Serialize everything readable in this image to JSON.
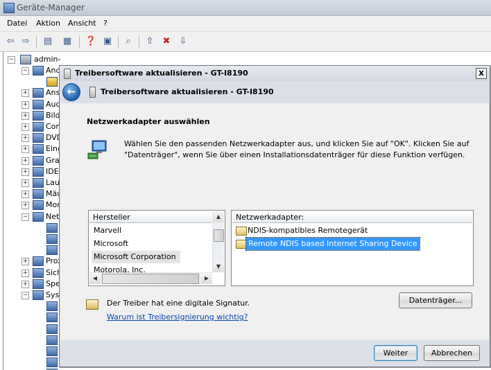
{
  "device_manager": {
    "title": "Geräte-Manager",
    "menu": [
      "Datei",
      "Aktion",
      "Ansicht",
      "?"
    ],
    "toolbar_icons": [
      "back-arrow-icon",
      "forward-arrow-icon",
      "console-tree-icon",
      "properties-icon",
      "help-icon",
      "action-pane-icon",
      "scan-hardware-icon",
      "update-driver-icon",
      "disable-device-icon",
      "uninstall-device-icon"
    ],
    "tree": {
      "root": "admin-PC",
      "items": [
        "And",
        "",
        "Ans",
        "Aud",
        "Bild",
        "Com",
        "DVD",
        "Eing",
        "Graf",
        "IDE",
        "Lauf",
        "Mäu",
        "Mon",
        "Netz",
        "",
        "",
        "",
        "Proz",
        "Sich",
        "Spe",
        "Syst",
        "",
        "",
        "",
        "",
        "",
        "",
        ""
      ]
    }
  },
  "dialog": {
    "title": "Treibersoftware aktualisieren - GT-I8190",
    "header_title": "Treibersoftware aktualisieren - GT-I8190",
    "section_title": "Netzwerkadapter auswählen",
    "description": "Wählen Sie den passenden Netzwerkadapter aus, und klicken Sie auf \"OK\". Klicken Sie auf \"Datenträger\", wenn Sie über einen Installationsdatenträger für diese Funktion verfügen.",
    "manufacturer_list": {
      "header": "Hersteller",
      "items": [
        "Marvell",
        "Microsoft",
        "Microsoft Corporation",
        "Motorola, Inc."
      ],
      "selected": "Microsoft Corporation"
    },
    "adapter_list": {
      "header": "Netzwerkadapter:",
      "items": [
        "NDIS-kompatibles Remotegerät",
        "Remote NDIS based Internet Sharing Device"
      ],
      "selected": "Remote NDIS based Internet Sharing Device"
    },
    "signature_text": "Der Treiber hat eine digitale Signatur.",
    "signature_link": "Warum ist Treibersignierung wichtig?",
    "have_disk_button": "Datenträger...",
    "next_button": "Weiter",
    "cancel_button": "Abbrechen",
    "close_glyph": "x"
  },
  "colors": {
    "selection": "#3399ff",
    "link": "#0645ad",
    "dialog_frame": "#dbe0e8"
  }
}
